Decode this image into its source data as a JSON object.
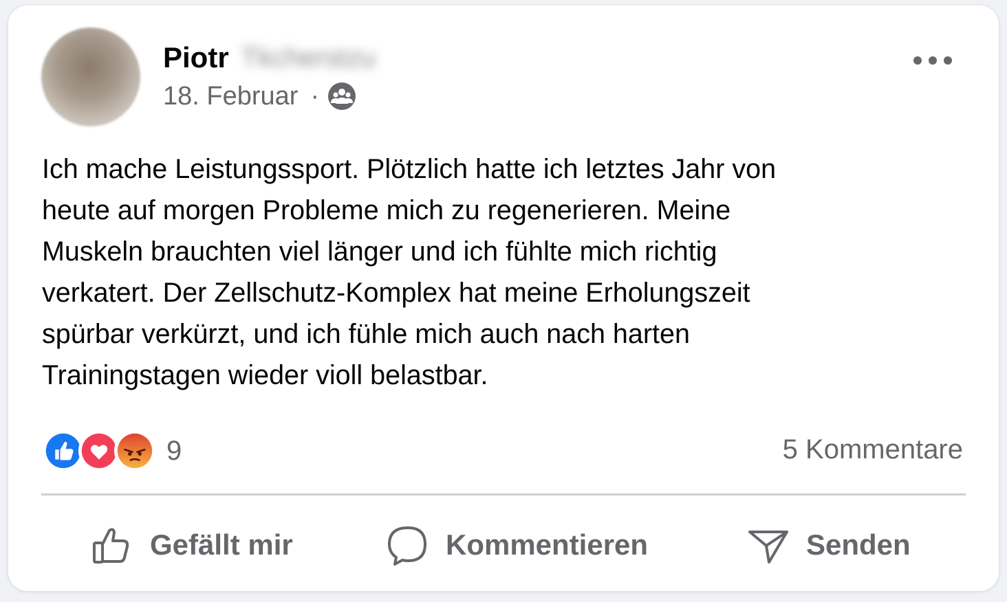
{
  "post": {
    "author_first": "Piotr",
    "author_last": "Tkcherstzu",
    "date": "18. Februar",
    "separator": "·",
    "audience_icon": "group-icon",
    "body": "Ich mache Leistungssport. Plötzlich hatte ich letztes Jahr von\nheute auf morgen Probleme mich zu regenerieren. Meine\nMuskeln brauchten viel länger und ich fühlte mich richtig\nverkatert. Der Zellschutz-Komplex hat meine Erholungszeit\nspürbar verkürzt, und ich fühle mich auch nach harten\nTrainingstagen wieder violl belastbar."
  },
  "stats": {
    "reactions": [
      "like",
      "love",
      "angry"
    ],
    "reaction_count": "9",
    "comments": "5 Kommentare"
  },
  "actions": {
    "like": "Gefällt mir",
    "comment": "Kommentieren",
    "send": "Senden"
  },
  "colors": {
    "like_blue": "#1877f2",
    "love_red": "#f33e58",
    "angry_orange": "#e9710f",
    "secondary_text": "#65676b"
  }
}
